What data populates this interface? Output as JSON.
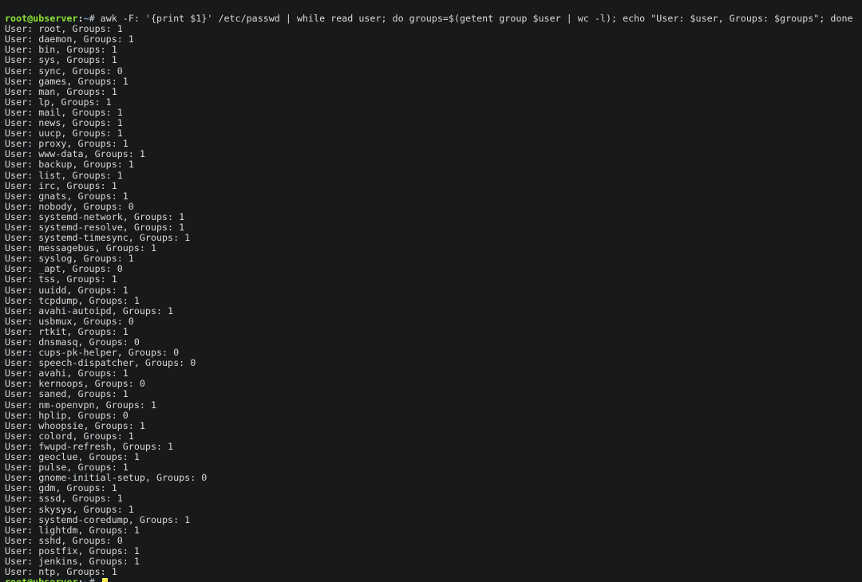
{
  "prompt": {
    "user_host": "root@ubserver",
    "cwd": "~",
    "symbol": "#"
  },
  "command": "awk -F: '{print $1}' /etc/passwd | while read user; do groups=$(getent group $user | wc -l); echo \"User: $user, Groups: $groups\"; done",
  "output_prefix_user": "User: ",
  "output_prefix_groups": ", Groups: ",
  "users": [
    {
      "name": "root",
      "groups": 1
    },
    {
      "name": "daemon",
      "groups": 1
    },
    {
      "name": "bin",
      "groups": 1
    },
    {
      "name": "sys",
      "groups": 1
    },
    {
      "name": "sync",
      "groups": 0
    },
    {
      "name": "games",
      "groups": 1
    },
    {
      "name": "man",
      "groups": 1
    },
    {
      "name": "lp",
      "groups": 1
    },
    {
      "name": "mail",
      "groups": 1
    },
    {
      "name": "news",
      "groups": 1
    },
    {
      "name": "uucp",
      "groups": 1
    },
    {
      "name": "proxy",
      "groups": 1
    },
    {
      "name": "www-data",
      "groups": 1
    },
    {
      "name": "backup",
      "groups": 1
    },
    {
      "name": "list",
      "groups": 1
    },
    {
      "name": "irc",
      "groups": 1
    },
    {
      "name": "gnats",
      "groups": 1
    },
    {
      "name": "nobody",
      "groups": 0
    },
    {
      "name": "systemd-network",
      "groups": 1
    },
    {
      "name": "systemd-resolve",
      "groups": 1
    },
    {
      "name": "systemd-timesync",
      "groups": 1
    },
    {
      "name": "messagebus",
      "groups": 1
    },
    {
      "name": "syslog",
      "groups": 1
    },
    {
      "name": "_apt",
      "groups": 0
    },
    {
      "name": "tss",
      "groups": 1
    },
    {
      "name": "uuidd",
      "groups": 1
    },
    {
      "name": "tcpdump",
      "groups": 1
    },
    {
      "name": "avahi-autoipd",
      "groups": 1
    },
    {
      "name": "usbmux",
      "groups": 0
    },
    {
      "name": "rtkit",
      "groups": 1
    },
    {
      "name": "dnsmasq",
      "groups": 0
    },
    {
      "name": "cups-pk-helper",
      "groups": 0
    },
    {
      "name": "speech-dispatcher",
      "groups": 0
    },
    {
      "name": "avahi",
      "groups": 1
    },
    {
      "name": "kernoops",
      "groups": 0
    },
    {
      "name": "saned",
      "groups": 1
    },
    {
      "name": "nm-openvpn",
      "groups": 1
    },
    {
      "name": "hplip",
      "groups": 0
    },
    {
      "name": "whoopsie",
      "groups": 1
    },
    {
      "name": "colord",
      "groups": 1
    },
    {
      "name": "fwupd-refresh",
      "groups": 1
    },
    {
      "name": "geoclue",
      "groups": 1
    },
    {
      "name": "pulse",
      "groups": 1
    },
    {
      "name": "gnome-initial-setup",
      "groups": 0
    },
    {
      "name": "gdm",
      "groups": 1
    },
    {
      "name": "sssd",
      "groups": 1
    },
    {
      "name": "skysys",
      "groups": 1
    },
    {
      "name": "systemd-coredump",
      "groups": 1
    },
    {
      "name": "lightdm",
      "groups": 1
    },
    {
      "name": "sshd",
      "groups": 0
    },
    {
      "name": "postfix",
      "groups": 1
    },
    {
      "name": "jenkins",
      "groups": 1
    },
    {
      "name": "ntp",
      "groups": 1
    }
  ]
}
